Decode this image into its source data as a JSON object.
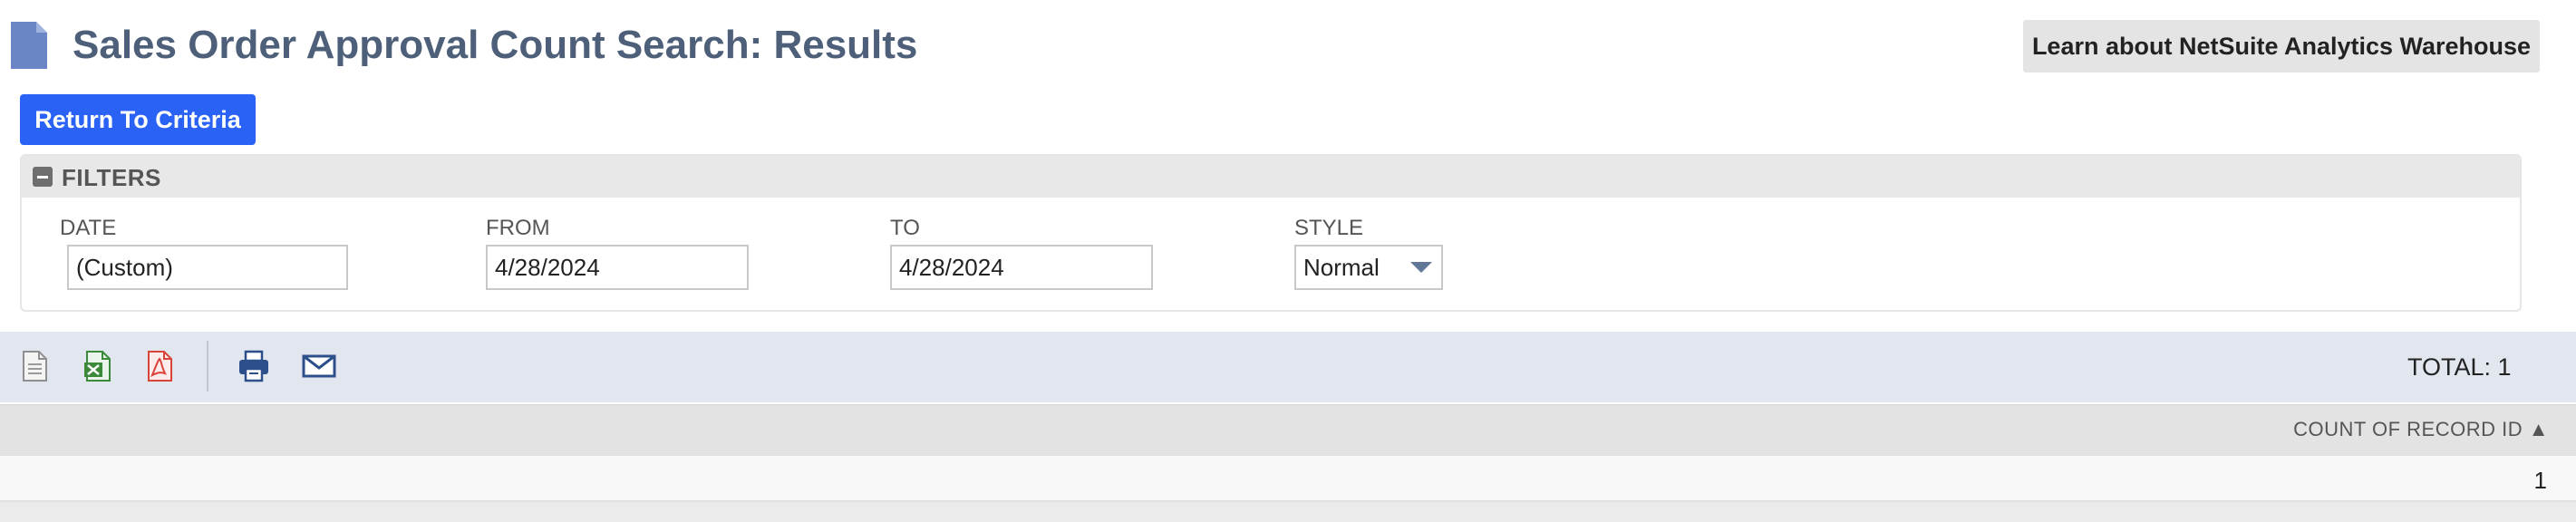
{
  "header": {
    "title": "Sales Order Approval Count Search: Results",
    "learn_button": "Learn about NetSuite Analytics Warehouse"
  },
  "actions": {
    "return_button": "Return To Criteria"
  },
  "filters": {
    "title": "FILTERS",
    "date": {
      "label": "DATE",
      "value": "(Custom)"
    },
    "from": {
      "label": "FROM",
      "value": "4/28/2024"
    },
    "to": {
      "label": "TO",
      "value": "4/28/2024"
    },
    "style": {
      "label": "STYLE",
      "value": "Normal"
    }
  },
  "toolbar": {
    "icons": [
      "csv-export-icon",
      "excel-export-icon",
      "pdf-export-icon",
      "print-icon",
      "email-icon"
    ],
    "total": "TOTAL: 1"
  },
  "table": {
    "columns": [
      "COUNT OF RECORD ID ▲"
    ],
    "rows": [
      [
        "1"
      ]
    ]
  },
  "colors": {
    "title": "#4d5f79",
    "primary_button": "#2a62f6",
    "toolbar_bg": "#e1e6ef",
    "excel": "#3a8a3a",
    "pdf": "#d9443a",
    "print": "#2d4f8c"
  }
}
